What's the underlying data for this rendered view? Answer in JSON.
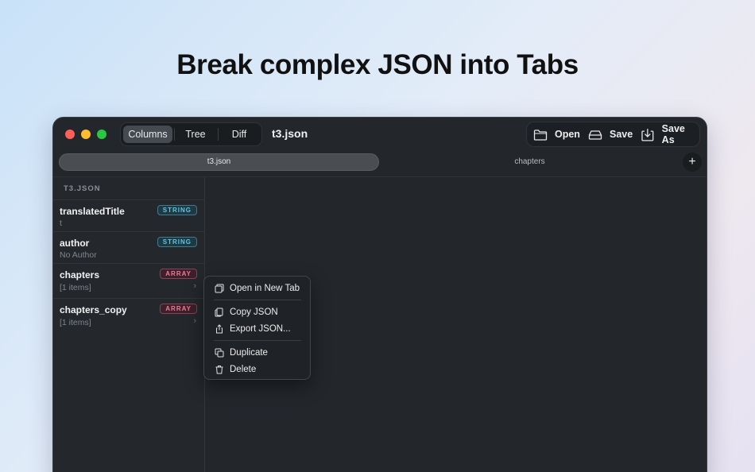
{
  "headline": "Break complex JSON into Tabs",
  "window": {
    "view_modes": [
      "Columns",
      "Tree",
      "Diff"
    ],
    "active_view": "Columns",
    "file_title": "t3.json",
    "toolbar": {
      "open_label": "Open",
      "save_label": "Save",
      "save_as_label": "Save As"
    },
    "tabs": [
      {
        "label": "t3.json",
        "active": true
      },
      {
        "label": "chapters",
        "active": false
      }
    ],
    "add_tab_label": "+",
    "column": {
      "header": "T3.JSON",
      "rows": [
        {
          "key": "translatedTitle",
          "value": "t",
          "type": "STRING"
        },
        {
          "key": "author",
          "value": "No Author",
          "type": "STRING"
        },
        {
          "key": "chapters",
          "value": "[1 items]",
          "type": "ARRAY"
        },
        {
          "key": "chapters_copy",
          "value": "[1 items]",
          "type": "ARRAY"
        }
      ]
    },
    "context_menu": {
      "items": [
        {
          "label": "Open in New Tab",
          "icon": "new-tab-icon"
        },
        {
          "label": "Copy JSON",
          "icon": "copy-icon"
        },
        {
          "label": "Export JSON...",
          "icon": "share-icon"
        },
        {
          "label": "Duplicate",
          "icon": "duplicate-icon"
        },
        {
          "label": "Delete",
          "icon": "trash-icon"
        }
      ]
    }
  },
  "colors": {
    "window_bg": "#23272c",
    "string_badge": "#5ec6e6",
    "array_badge": "#f07b9a",
    "traffic_red": "#fe5f57",
    "traffic_yellow": "#febc2e",
    "traffic_green": "#28c840"
  }
}
